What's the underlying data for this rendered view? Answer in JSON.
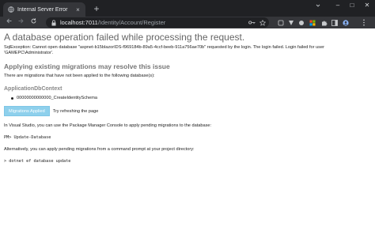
{
  "browser": {
    "tab": {
      "title": "Internal Server Error",
      "close_glyph": "×"
    },
    "new_tab_glyph": "+",
    "window": {
      "minimize": "–",
      "maximize": "□",
      "close": "✕"
    },
    "address": {
      "host": "localhost:7011",
      "path": "/Identity/Account/Register"
    }
  },
  "page": {
    "title": "A database operation failed while processing the request.",
    "exception": "SqlException: Cannot open database \"aspnet-b15blazorIDS-f969184b-89a5-4ccf-beeb-911a756ae70b\" requested by the login. The login failed. Login failed for user 'GAMEPC\\Administrator'.",
    "migrations_heading": "Applying existing migrations may resolve this issue",
    "migrations_intro": "There are migrations that have not been applied to the following database(s):",
    "context_name": "ApplicationDbContext",
    "migrations": [
      "00000000000000_CreateIdentitySchema"
    ],
    "apply_button": "Migrations Applied",
    "apply_note": "Try refreshing the page",
    "pmc_text": "In Visual Studio, you can use the Package Manager Console to apply pending migrations to the database:",
    "pmc_command": "PM> Update-Database",
    "cli_text": "Alternatively, you can apply pending migrations from a command prompt at your project directory:",
    "cli_command": "> dotnet ef database update"
  }
}
